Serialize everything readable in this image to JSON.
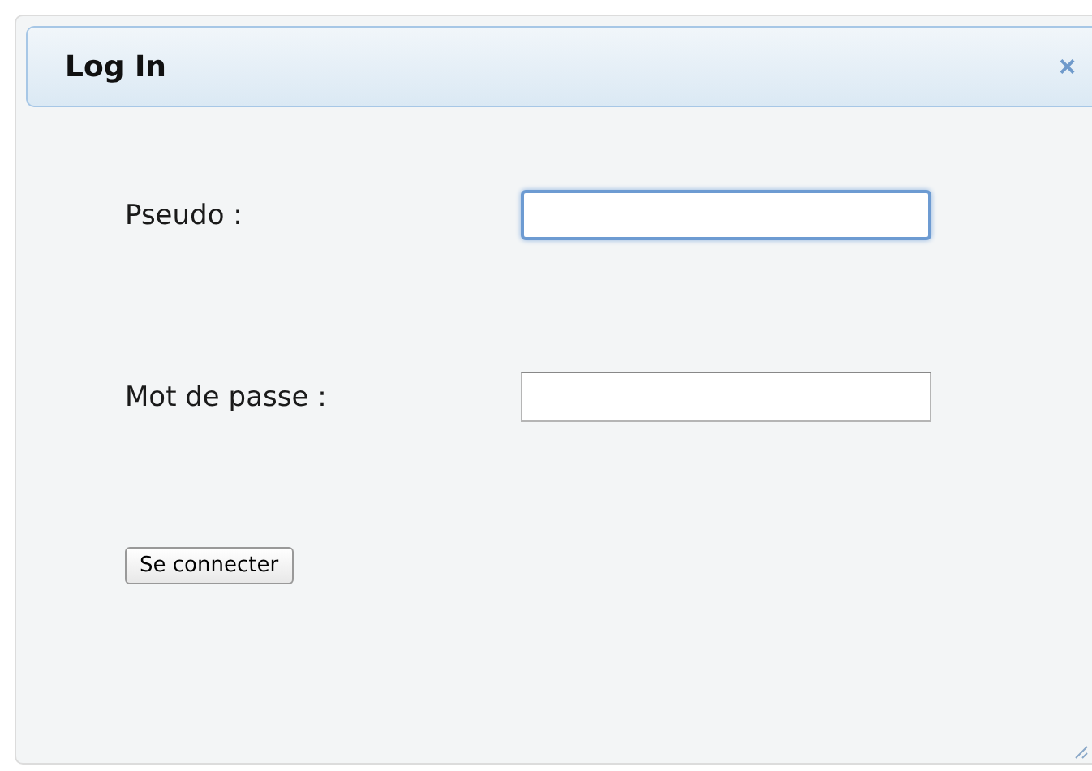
{
  "dialog": {
    "title": "Log In",
    "close": "×"
  },
  "fields": [
    {
      "label": "Pseudo :",
      "focused": true
    },
    {
      "label": "Mot de passe :",
      "focused": false
    }
  ],
  "submit": "Se connecter"
}
